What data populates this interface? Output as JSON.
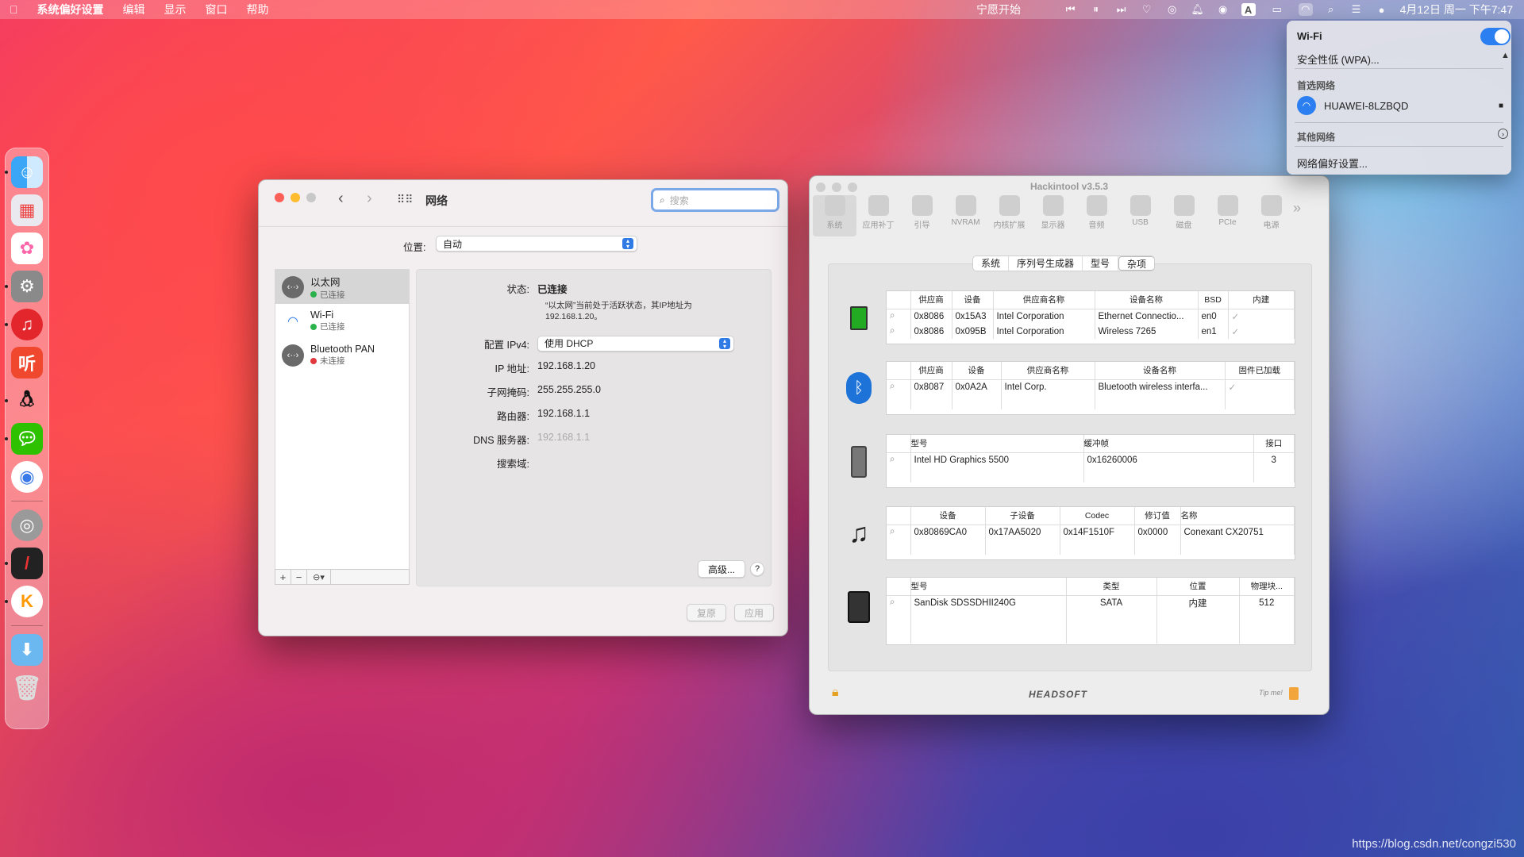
{
  "menubar": {
    "app": "系统偏好设置",
    "items": [
      "编辑",
      "显示",
      "窗口",
      "帮助"
    ],
    "center": "宁愿开始",
    "datetime": "4月12日 周一 下午7:47"
  },
  "network": {
    "title": "网络",
    "search_placeholder": "搜索",
    "location_label": "位置:",
    "location_value": "自动",
    "services": [
      {
        "name": "以太网",
        "status": "已连接",
        "color": "#2bb24c"
      },
      {
        "name": "Wi-Fi",
        "status": "已连接",
        "color": "#2bb24c"
      },
      {
        "name": "Bluetooth PAN",
        "status": "未连接",
        "color": "#e0393e"
      }
    ],
    "status_label": "状态:",
    "status_value": "已连接",
    "status_desc": "“以太网”当前处于活跃状态，其IP地址为 192.168.1.20。",
    "ipv4_label": "配置 IPv4:",
    "ipv4_value": "使用 DHCP",
    "ip_label": "IP 地址:",
    "ip_value": "192.168.1.20",
    "mask_label": "子网掩码:",
    "mask_value": "255.255.255.0",
    "router_label": "路由器:",
    "router_value": "192.168.1.1",
    "dns_label": "DNS 服务器:",
    "dns_value": "192.168.1.1",
    "domain_label": "搜索域:",
    "advanced": "高级...",
    "help": "?",
    "revert": "复原",
    "apply": "应用"
  },
  "hackintool": {
    "title": "Hackintool v3.5.3",
    "tools": [
      "系统",
      "应用补丁",
      "引导",
      "NVRAM",
      "内核扩展",
      "显示器",
      "音频",
      "USB",
      "磁盘",
      "PCIe",
      "电源"
    ],
    "tabs": [
      "系统",
      "序列号生成器",
      "型号",
      "杂项"
    ],
    "network_table": {
      "headers": [
        "供应商",
        "设备",
        "供应商名称",
        "设备名称",
        "BSD",
        "内建"
      ],
      "rows": [
        [
          "0x8086",
          "0x15A3",
          "Intel Corporation",
          "Ethernet Connectio...",
          "en0",
          "✓"
        ],
        [
          "0x8086",
          "0x095B",
          "Intel Corporation",
          "Wireless 7265",
          "en1",
          "✓"
        ]
      ]
    },
    "bt_table": {
      "headers": [
        "供应商",
        "设备",
        "供应商名称",
        "设备名称",
        "固件已加载"
      ],
      "rows": [
        [
          "0x8087",
          "0x0A2A",
          "Intel Corp.",
          "Bluetooth wireless interfa...",
          "✓"
        ]
      ]
    },
    "gpu_table": {
      "headers": [
        "型号",
        "缓冲帧",
        "接口"
      ],
      "rows": [
        [
          "Intel HD Graphics 5500",
          "0x16260006",
          "3"
        ]
      ]
    },
    "audio_table": {
      "headers": [
        "设备",
        "子设备",
        "Codec",
        "修订值",
        "名称"
      ],
      "rows": [
        [
          "0x80869CA0",
          "0x17AA5020",
          "0x14F1510F",
          "0x0000",
          "Conexant CX20751"
        ]
      ]
    },
    "disk_table": {
      "headers": [
        "型号",
        "类型",
        "位置",
        "物理块..."
      ],
      "rows": [
        [
          "SanDisk SDSSDHII240G",
          "SATA",
          "内建",
          "512"
        ]
      ]
    },
    "brand": "HEADSOFT",
    "tip": "Tip me!"
  },
  "wifi_menu": {
    "title": "Wi-Fi",
    "security": "安全性低 (WPA)...",
    "preferred_header": "首选网络",
    "network_name": "HUAWEI-8LZBQD",
    "other": "其他网络",
    "prefs": "网络偏好设置..."
  },
  "watermark": "https://blog.csdn.net/congzi530"
}
